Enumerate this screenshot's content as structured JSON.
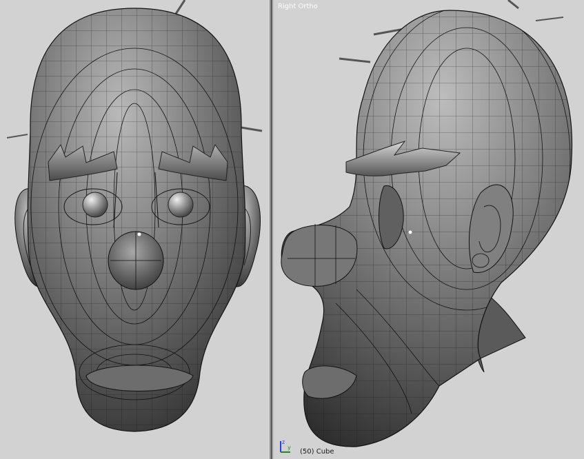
{
  "left_view": {
    "label": "",
    "object_info": ""
  },
  "right_view": {
    "label": "Right Ortho",
    "object_info": "(50) Cube"
  },
  "axis_gizmo": {
    "up_axis": "z",
    "forward_axis": "y",
    "up_color": "#1f3cff",
    "forward_color": "#1e8a1e"
  },
  "icons": {
    "model": "head-mesh-wireframe"
  },
  "colors": {
    "viewport_bg": "#d2d2d2",
    "mesh_shade": "#6a6a6a",
    "wire": "#111111"
  }
}
